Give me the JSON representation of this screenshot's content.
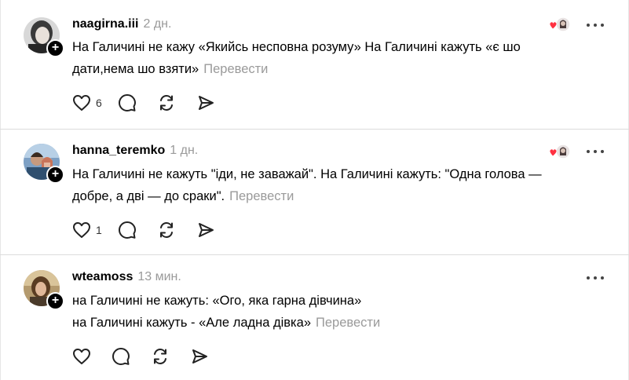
{
  "posts": [
    {
      "username": "naagirna.iii",
      "time": "2 дн.",
      "lines": [
        "На Галичині не кажу «Якийсь несповна розуму» На Галичині кажуть «є шо",
        "дати,нема шо взяти»"
      ],
      "translate": "Перевести",
      "likes": "6",
      "has_reactions": true
    },
    {
      "username": "hanna_teremko",
      "time": "1 дн.",
      "lines": [
        "На Галичині не кажуть \"іди, не заважай\". На Галичині кажуть: \"Одна голова —",
        "добре, а дві — до сраки\"."
      ],
      "translate": "Перевести",
      "likes": "1",
      "has_reactions": true
    },
    {
      "username": "wteamoss",
      "time": "13 мин.",
      "lines": [
        "на Галичині не кажуть: «Ого, яка гарна дівчина»",
        "на Галичині кажуть - «Але ладна дівка»"
      ],
      "translate": "Перевести",
      "likes": "",
      "has_reactions": false
    }
  ],
  "icons": {
    "like": "heart-icon",
    "reply": "comment-icon",
    "repost": "repost-icon",
    "share": "send-icon",
    "more": "more-icon",
    "follow": "plus-icon"
  },
  "colors": {
    "reaction_heart": "#ff3040",
    "muted_text": "#9a9a9a",
    "separator": "#dcdcdc"
  }
}
